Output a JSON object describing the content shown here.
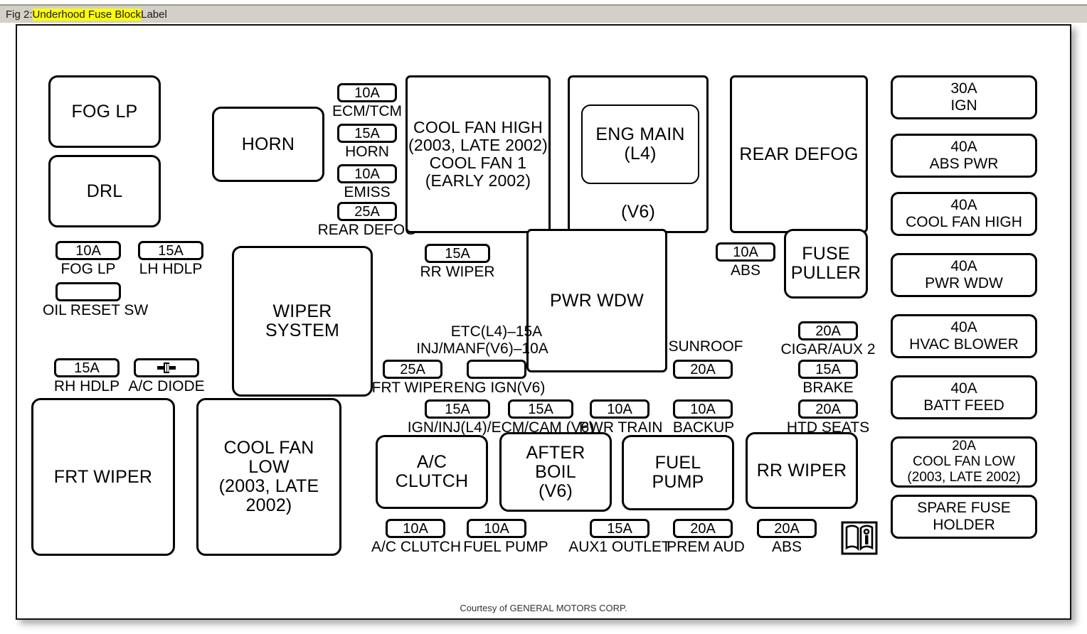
{
  "caption": {
    "prefix": "Fig 2: ",
    "highlight": "Underhood Fuse Block",
    "suffix": " Label"
  },
  "credit": "Courtesy of GENERAL MOTORS CORP.",
  "colors": {
    "highlight": "#ffff00",
    "caption_bar": "#d4d0c8",
    "outline": "#000000",
    "sheet": "#ffffff"
  },
  "relays": {
    "fog_lp": "FOG LP",
    "drl": "DRL",
    "horn": "HORN",
    "wiper_system": "WIPER SYSTEM",
    "frt_wiper": "FRT WIPER",
    "cool_fan_low": "COOL FAN LOW (2003, LATE 2002)",
    "cool_fan_high": "COOL FAN HIGH (2003, LATE 2002) COOL FAN 1 (EARLY 2002)",
    "eng_main_outer": "(V6)",
    "eng_main_inner": "ENG MAIN (L4)",
    "rear_defog": "REAR DEFOG",
    "pwr_wdw": "PWR WDW",
    "fuse_puller": "FUSE PULLER",
    "ac_clutch": "A/C CLUTCH",
    "after_boil": "AFTER BOIL (V6)",
    "fuel_pump": "FUEL PUMP",
    "rr_wiper": "RR WIPER"
  },
  "fuses": {
    "fog_lp": {
      "amp": "10A",
      "label": "FOG LP"
    },
    "lh_hdlp": {
      "amp": "15A",
      "label": "LH HDLP"
    },
    "oil_reset_sw": {
      "amp": "",
      "label": "OIL RESET SW"
    },
    "rh_hdlp": {
      "amp": "15A",
      "label": "RH HDLP"
    },
    "ac_diode": {
      "amp": "",
      "label": "A/C DIODE",
      "icon": "diode-icon"
    },
    "ecm_tcm": {
      "amp": "10A",
      "label": "ECM/TCM"
    },
    "horn": {
      "amp": "15A",
      "label": "HORN"
    },
    "emiss": {
      "amp": "10A",
      "label": "EMISS"
    },
    "rear_defog": {
      "amp": "25A",
      "label": "REAR DEFOG"
    },
    "rr_wiper": {
      "amp": "15A",
      "label": "RR WIPER"
    },
    "frt_wiper": {
      "amp": "25A",
      "label": "FRT WIPER"
    },
    "eng_ign_v6": {
      "amp": "",
      "label": "ENG IGN(V6)",
      "above1": "ETC(L4)–15A",
      "above2": "INJ/MANF(V6)–10A"
    },
    "ign_inj_l4": {
      "amp": "15A",
      "label": "IGN/INJ(L4)/ECM/CAM (V6)"
    },
    "ecm_cam_v6": {
      "amp": "15A"
    },
    "pwr_train": {
      "amp": "10A",
      "label": "PWR TRAIN"
    },
    "backup": {
      "amp": "10A",
      "label": "BACKUP"
    },
    "sunroof": {
      "amp": "20A",
      "label": "SUNROOF"
    },
    "abs_top": {
      "amp": "10A",
      "label": "ABS"
    },
    "cigar_aux2": {
      "amp": "20A",
      "label": "CIGAR/AUX 2"
    },
    "brake": {
      "amp": "15A",
      "label": "BRAKE"
    },
    "htd_seats": {
      "amp": "20A",
      "label": "HTD SEATS"
    },
    "ac_clutch": {
      "amp": "10A",
      "label": "A/C CLUTCH"
    },
    "fuel_pump": {
      "amp": "10A",
      "label": "FUEL PUMP"
    },
    "aux1_outlet": {
      "amp": "15A",
      "label": "AUX1 OUTLET"
    },
    "prem_aud": {
      "amp": "20A",
      "label": "PREM AUD"
    },
    "abs_bottom": {
      "amp": "20A",
      "label": "ABS"
    }
  },
  "maxi_fuses": [
    {
      "amp": "30A",
      "label": "IGN"
    },
    {
      "amp": "40A",
      "label": "ABS PWR"
    },
    {
      "amp": "40A",
      "label": "COOL FAN HIGH"
    },
    {
      "amp": "40A",
      "label": "PWR WDW"
    },
    {
      "amp": "40A",
      "label": "HVAC BLOWER"
    },
    {
      "amp": "40A",
      "label": "BATT FEED"
    },
    {
      "amp": "20A",
      "label": "COOL FAN LOW (2003, LATE 2002)"
    },
    {
      "amp": "",
      "label": "SPARE FUSE HOLDER"
    }
  ],
  "maxi_rows": {
    "r0_amp": "30A",
    "r0_label": "IGN",
    "r1_amp": "40A",
    "r1_label": "ABS PWR",
    "r2_amp": "40A",
    "r2_label": "COOL FAN HIGH",
    "r3_amp": "40A",
    "r3_label": "PWR WDW",
    "r4_amp": "40A",
    "r4_label": "HVAC BLOWER",
    "r5_amp": "40A",
    "r5_label": "BATT FEED",
    "r6_amp": "20A",
    "r6_label": "COOL FAN LOW",
    "r6_label2": "(2003, LATE 2002)",
    "r7_label": "SPARE FUSE",
    "r7_label2": "HOLDER"
  },
  "relay_lines": {
    "cool_fan_high_l1": "COOL FAN HIGH",
    "cool_fan_high_l2": "(2003, LATE 2002)",
    "cool_fan_high_l3": "COOL FAN 1",
    "cool_fan_high_l4": "(EARLY 2002)",
    "cool_fan_low_l1": "COOL FAN",
    "cool_fan_low_l2": "LOW",
    "cool_fan_low_l3": "(2003, LATE",
    "cool_fan_low_l4": "2002)",
    "wiper_l1": "WIPER",
    "wiper_l2": "SYSTEM",
    "eng_main_l1": "ENG MAIN",
    "eng_main_l2": "(L4)",
    "eng_main_v6": "(V6)",
    "fuse_puller_l1": "FUSE",
    "fuse_puller_l2": "PULLER",
    "ac_clutch_l1": "A/C",
    "ac_clutch_l2": "CLUTCH",
    "after_boil_l1": "AFTER",
    "after_boil_l2": "BOIL",
    "after_boil_l3": "(V6)",
    "fuel_pump_l1": "FUEL",
    "fuel_pump_l2": "PUMP"
  },
  "icons": {
    "manual": "manual-book-icon",
    "diode": "diode-icon"
  }
}
